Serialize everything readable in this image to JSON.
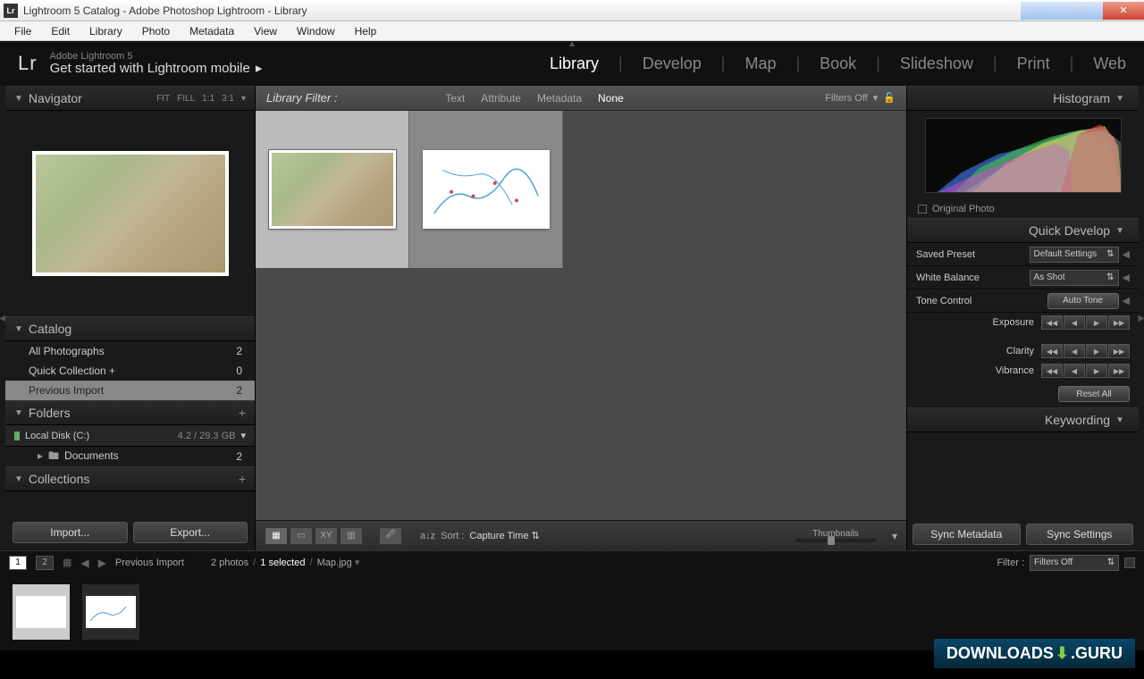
{
  "window": {
    "title": "Lightroom 5 Catalog - Adobe Photoshop Lightroom - Library",
    "app_icon": "Lr"
  },
  "menubar": [
    "File",
    "Edit",
    "Library",
    "Photo",
    "Metadata",
    "View",
    "Window",
    "Help"
  ],
  "header": {
    "logo": "Lr",
    "subtitle": "Adobe Lightroom 5",
    "title": "Get started with Lightroom mobile"
  },
  "modules": [
    "Library",
    "Develop",
    "Map",
    "Book",
    "Slideshow",
    "Print",
    "Web"
  ],
  "active_module": "Library",
  "navigator": {
    "title": "Navigator",
    "zoom": [
      "FIT",
      "FILL",
      "1:1",
      "3:1"
    ]
  },
  "catalog": {
    "title": "Catalog",
    "rows": [
      {
        "label": "All Photographs",
        "count": "2"
      },
      {
        "label": "Quick Collection  +",
        "count": "0"
      },
      {
        "label": "Previous Import",
        "count": "2",
        "selected": true
      }
    ]
  },
  "folders": {
    "title": "Folders",
    "disk": "Local Disk (C:)",
    "disk_usage": "4.2 / 29.3 GB",
    "sub": {
      "label": "Documents",
      "count": "2"
    }
  },
  "collections": {
    "title": "Collections"
  },
  "buttons": {
    "import": "Import...",
    "export": "Export..."
  },
  "filter_bar": {
    "label": "Library Filter :",
    "tabs": [
      "Text",
      "Attribute",
      "Metadata",
      "None"
    ],
    "active": "None",
    "filters_off": "Filters Off"
  },
  "toolbar": {
    "sort_label": "Sort :",
    "sort_value": "Capture Time",
    "thumbnails_label": "Thumbnails"
  },
  "histogram": {
    "title": "Histogram",
    "original": "Original Photo"
  },
  "quick_develop": {
    "title": "Quick Develop",
    "saved_preset_label": "Saved Preset",
    "saved_preset_value": "Default Settings",
    "wb_label": "White Balance",
    "wb_value": "As Shot",
    "tone_label": "Tone Control",
    "auto_tone": "Auto Tone",
    "exposure": "Exposure",
    "clarity": "Clarity",
    "vibrance": "Vibrance",
    "reset": "Reset All"
  },
  "keywording": {
    "title": "Keywording"
  },
  "sync": {
    "metadata": "Sync Metadata",
    "settings": "Sync Settings"
  },
  "info_bar": {
    "pages": [
      "1",
      "2"
    ],
    "source": "Previous Import",
    "count": "2 photos",
    "selected": "1 selected",
    "filename": "Map.jpg",
    "filter_label": "Filter :",
    "filter_value": "Filters Off"
  },
  "watermark": {
    "a": "DOWNLOADS",
    "b": ".GURU"
  }
}
